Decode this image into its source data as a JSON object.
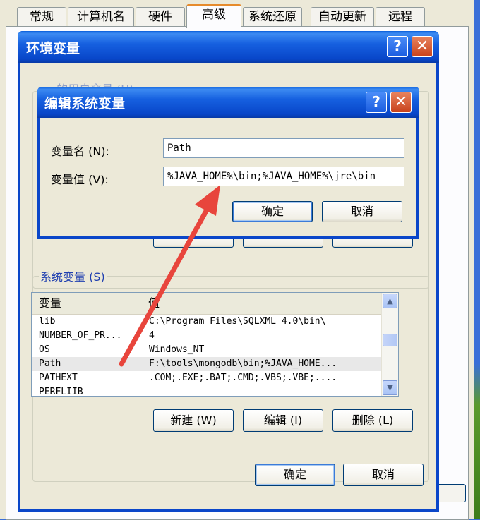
{
  "system_properties": {
    "tabs": [
      {
        "label": "常规",
        "active": false
      },
      {
        "label": "计算机名",
        "active": false
      },
      {
        "label": "硬件",
        "active": false
      },
      {
        "label": "高级",
        "active": true
      },
      {
        "label": "系统还原",
        "active": false
      },
      {
        "label": "自动更新",
        "active": false
      },
      {
        "label": "远程",
        "active": false
      }
    ]
  },
  "env_dialog": {
    "title": "环境变量",
    "user_vars_caption": "… 的用户变量 (U)",
    "system_vars_caption": "系统变量 (S)",
    "list_headers": {
      "name": "变量",
      "value": "值"
    },
    "rows": [
      {
        "name": "lib",
        "value": "C:\\Program Files\\SQLXML 4.0\\bin\\",
        "selected": false
      },
      {
        "name": "NUMBER_OF_PR...",
        "value": "4",
        "selected": false
      },
      {
        "name": "OS",
        "value": "Windows_NT",
        "selected": false
      },
      {
        "name": "Path",
        "value": "F:\\tools\\mongodb\\bin;%JAVA_HOME...",
        "selected": true
      },
      {
        "name": "PATHEXT",
        "value": ".COM;.EXE;.BAT;.CMD;.VBS;.VBE;....",
        "selected": false
      },
      {
        "name": "PERFLIIB",
        "value": "",
        "selected": false
      }
    ],
    "new_button": "新建 (W)",
    "edit_button": "编辑 (I)",
    "delete_button": "删除 (L)",
    "ok_button": "确定",
    "cancel_button": "取消"
  },
  "edit_dialog": {
    "title": "编辑系统变量",
    "name_label": "变量名 (N):",
    "value_label": "变量值 (V):",
    "name_value": "Path",
    "value_value": "%JAVA_HOME%\\bin;%JAVA_HOME%\\jre\\bin",
    "ok_button": "确定",
    "cancel_button": "取消"
  },
  "colors": {
    "titlebar_blue": "#0a46c9",
    "dialog_face": "#ece9d8",
    "annotation_arrow": "#e8453c"
  }
}
